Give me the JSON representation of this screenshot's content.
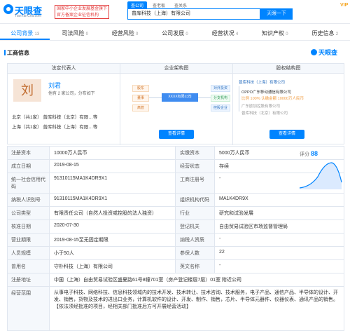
{
  "header": {
    "logo": "天眼查",
    "domain": "TianYanCha.com",
    "gov_badge": [
      "国家中小企业发展基金旗下",
      "官方备案企业征信机构"
    ],
    "search_tabs": [
      "查公司",
      "查老板",
      "查关系"
    ],
    "search_value": "普库科技（上海）有限公司",
    "search_button": "天眼一下",
    "vip": "VIP"
  },
  "tabs": [
    {
      "label": "公司背景",
      "count": "13"
    },
    {
      "label": "司法风险",
      "count": "0"
    },
    {
      "label": "经营风险",
      "count": "0"
    },
    {
      "label": "公司发展",
      "count": "0"
    },
    {
      "label": "经营状况",
      "count": "4"
    },
    {
      "label": "知识产权",
      "count": "0"
    },
    {
      "label": "历史信息",
      "count": "2"
    }
  ],
  "section_title": "工商信息",
  "watermark": "天眼查",
  "legal_rep": {
    "header": "法定代表人",
    "avatar_char": "刘",
    "name": "刘君",
    "desc": "他有 2 家公司，分布如下",
    "lines": [
      "北京（共1家）   普库科技（北京）有限…等",
      "上海（共1家）   普库科技（上海）有限…等"
    ]
  },
  "structure": {
    "header": "企业架构图",
    "nodes": [
      "股东",
      "董事",
      "高管",
      "XXXX有限公司",
      "对外投资",
      "分支机构",
      "控股企业"
    ],
    "button": "查看详情"
  },
  "equity": {
    "header": "股权结构图",
    "top": "普库科技（上海）有限公司",
    "items": [
      "OPPO广东移动通信有限公司",
      "比例 100%    认缴金额 10000万人民币",
      "广东欧加控股有限公司",
      "普库科技（北京）有限公司"
    ],
    "button": "查看详情"
  },
  "score": {
    "label": "评分",
    "value": "88"
  },
  "rows": [
    {
      "k1": "注册资本",
      "v1": "10000万人民币",
      "k2": "实缴资本",
      "v2": "5000万人民币"
    },
    {
      "k1": "成立日期",
      "v1": "2019-08-15",
      "k2": "经营状态",
      "v2": "存续"
    },
    {
      "k1": "统一社会信用代码",
      "v1": "91310115MA1K4DR9X1",
      "k2": "工商注册号",
      "v2": "-"
    },
    {
      "k1": "纳税人识别号",
      "v1": "91310115MA1K4DR9X1",
      "k2": "组织机构代码",
      "v2": "MA1K4DR9X"
    },
    {
      "k1": "公司类型",
      "v1": "有限责任公司（自然人投资或控股的法人独资）",
      "k2": "行业",
      "v2": "研究和试验发展"
    },
    {
      "k1": "核准日期",
      "v1": "2020-07-30",
      "k2": "登记机关",
      "v2": "自由贸易试验区市场监督管理局"
    },
    {
      "k1": "营业期限",
      "v1": "2019-08-15至无固定期限",
      "k2": "纳税人资质",
      "v2": "-"
    },
    {
      "k1": "人员规模",
      "v1": "小于50人",
      "k2": "参保人数",
      "v2": "22"
    },
    {
      "k1": "曾用名",
      "v1": "守朴科技（上海）有限公司",
      "k2": "英文名称",
      "v2": "-"
    }
  ],
  "address": {
    "k": "注册地址",
    "v": "中国（上海）自由贸易试验区盛夏路61号8幢701室（房产登记楼层7层）01室 附近公司"
  },
  "scope": {
    "k": "经营范围",
    "v": "从事电子科技、网络科技、信息科技领域内的技术开发、技术转让、技术咨询、技术服务，电子产品、通信产品、半导体的设计、开发、销售，货物及技术的进出口业务，计算机软件的设计、开发、制作、销售，芯片、半导体元器件、仪器仪表、通讯产品的销售。【依法须经批准的项目，经相关部门批准后方可开展经营活动】"
  }
}
